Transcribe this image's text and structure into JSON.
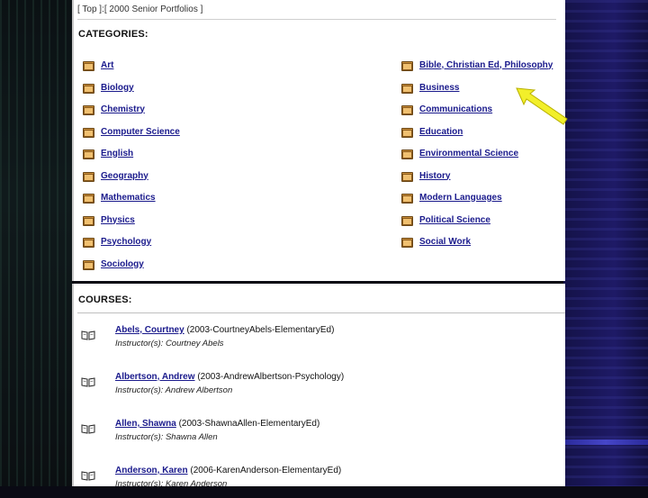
{
  "breadcrumb": {
    "top": "Top",
    "separator": ":",
    "current": "2000 Senior Portfolios"
  },
  "categories": {
    "title": "CATEGORIES:",
    "left": [
      "Art",
      "Biology",
      "Chemistry",
      "Computer Science",
      "English",
      "Geography",
      "Mathematics",
      "Physics",
      "Psychology",
      "Sociology"
    ],
    "right": [
      "Bible, Christian Ed, Philosophy",
      "Business",
      "Communications",
      "Education",
      "Environmental Science",
      "History",
      "Modern Languages",
      "Political Science",
      "Social Work"
    ]
  },
  "courses": {
    "title": "COURSES:",
    "items": [
      {
        "name": "Abels, Courtney",
        "code": "(2003-CourtneyAbels-ElementaryEd)",
        "instructor": "Instructor(s): Courtney Abels"
      },
      {
        "name": "Albertson, Andrew",
        "code": "(2003-AndrewAlbertson-Psychology)",
        "instructor": "Instructor(s): Andrew Albertson"
      },
      {
        "name": "Allen, Shawna",
        "code": "(2003-ShawnaAllen-ElementaryEd)",
        "instructor": "Instructor(s): Shawna Allen"
      },
      {
        "name": "Anderson, Karen",
        "code": "(2006-KarenAnderson-ElementaryEd)",
        "instructor": "Instructor(s): Karen Anderson"
      }
    ]
  },
  "annotation": {
    "color": "#f2ef2a",
    "points_to": "Business"
  },
  "colors": {
    "link": "#1a1a8c",
    "folder": "#c98e3a"
  }
}
